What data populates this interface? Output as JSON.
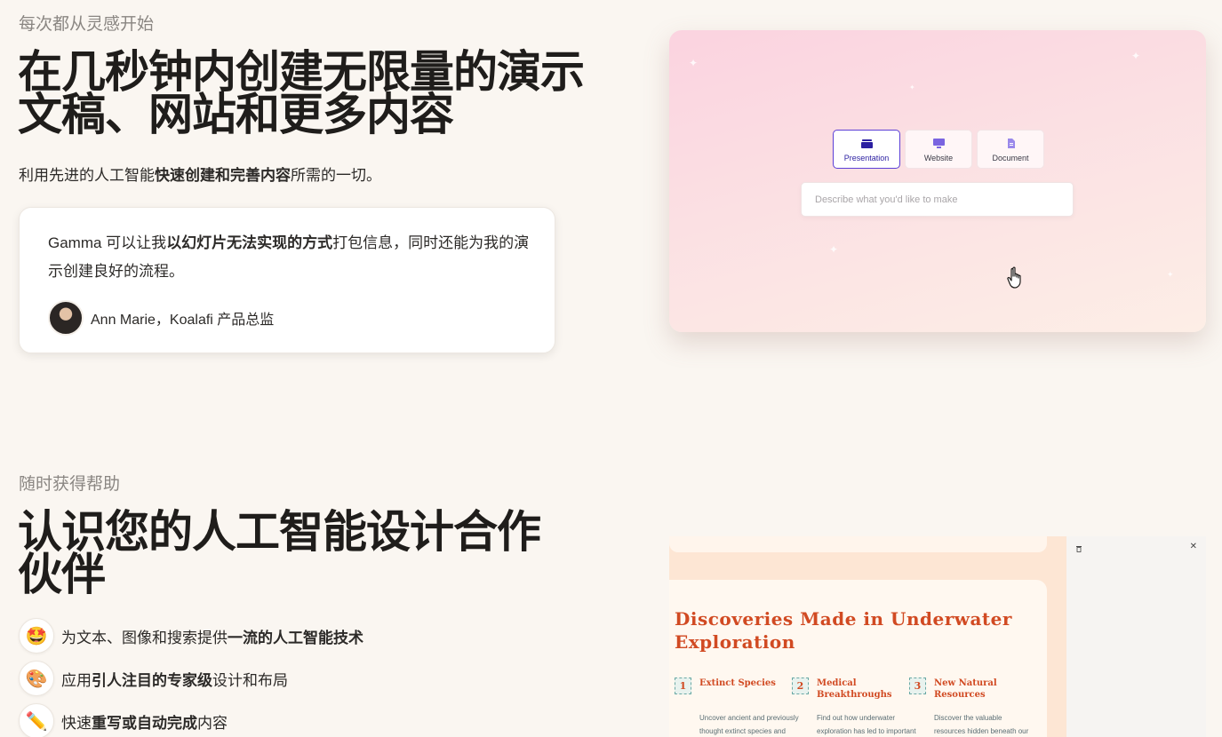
{
  "section1": {
    "eyebrow": "每次都从灵感开始",
    "headline": "在几秒钟内创建无限量的演示文稿、网站和更多内容",
    "sub_pre": "利用先进的人工智能",
    "sub_bold": "快速创建和完善内容",
    "sub_post": "所需的一切。",
    "quote": {
      "pre": "Gamma 可以让我",
      "bold": "以幻灯片无法实现的方式",
      "post": "打包信息，同时还能为我的演示创建良好的流程。",
      "author": "Ann Marie，Koalafi 产品总监"
    },
    "hero": {
      "types": [
        {
          "label": "Presentation",
          "icon": "presentation-icon"
        },
        {
          "label": "Website",
          "icon": "monitor-icon"
        },
        {
          "label": "Document",
          "icon": "document-icon"
        }
      ],
      "placeholder": "Describe what you'd like to make",
      "accent": "#5b3fd6"
    }
  },
  "section2": {
    "eyebrow": "随时获得帮助",
    "headline": "认识您的人工智能设计合作伙伴",
    "features": [
      {
        "icon": "star-struck-icon",
        "glyph": "🤩",
        "pre": "为文本、图像和搜索提供",
        "bold": "一流的人工智能技术",
        "post": ""
      },
      {
        "icon": "palette-icon",
        "glyph": "🎨",
        "pre": "应用",
        "bold": "引人注目的专家级",
        "post": "设计和布局"
      },
      {
        "icon": "pencil-icon",
        "glyph": "✏️",
        "pre": "快速",
        "bold": "重写或自动完成",
        "post": "内容"
      }
    ],
    "doc": {
      "title": "Discoveries Made in Underwater Exploration",
      "columns": [
        {
          "num": "1",
          "heading": "Extinct Species",
          "body": "Uncover ancient and previously thought extinct species and learn"
        },
        {
          "num": "2",
          "heading": "Medical Breakthroughs",
          "body": "Find out how underwater exploration has led to important medical breakthroughs"
        },
        {
          "num": "3",
          "heading": "New Natural Resources",
          "body": "Discover the valuable resources hidden beneath our oceans and how their"
        }
      ],
      "title_color": "#d14a22"
    }
  }
}
